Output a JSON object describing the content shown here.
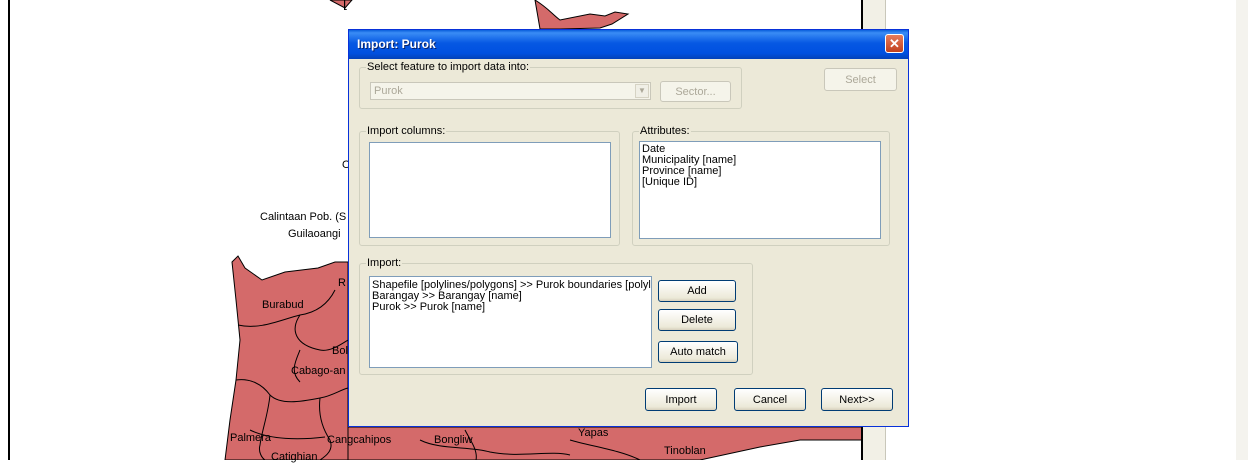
{
  "map": {
    "labels": {
      "o": "O",
      "calintaan": "Calintaan Pob. (S",
      "guilaoangi": "Guilaoangi",
      "r": "R",
      "burabud": "Burabud",
      "bol": "Bol",
      "cabago": "Cabago-an",
      "palmera": "Palmera",
      "cangcahipos": "Cangcahipos",
      "bongliw": "Bongliw",
      "yapas": "Yapas",
      "tinoblan": "Tinoblan",
      "catighian": "Catighian",
      "top_bracket": "["
    },
    "fill_color": "#d46a6a"
  },
  "dialog": {
    "title": "Import: Purok",
    "close_glyph": "✕",
    "select_group": {
      "label": "Select feature to import data into:",
      "combo_value": "Purok",
      "sector_label": "Sector..."
    },
    "select_button": "Select",
    "import_columns": {
      "label": "Import columns:"
    },
    "attributes": {
      "label": "Attributes:",
      "items": [
        "Date",
        "Municipality [name]",
        "Province [name]",
        "[Unique ID]"
      ]
    },
    "import_group": {
      "label": "Import:",
      "items": [
        "Shapefile [polylines/polygons] >> Purok boundaries [polylines",
        "Barangay >> Barangay [name]",
        "Purok >> Purok [name]"
      ],
      "add": "Add",
      "delete": "Delete",
      "auto_match": "Auto match"
    },
    "footer": {
      "import": "Import",
      "cancel": "Cancel",
      "next": "Next>>"
    }
  }
}
